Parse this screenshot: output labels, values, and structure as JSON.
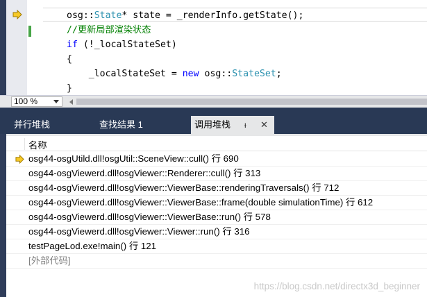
{
  "editor": {
    "lines": [
      {
        "parts": [
          {
            "t": "osg::",
            "c": ""
          },
          {
            "t": "State",
            "c": "type"
          },
          {
            "t": "* state = _renderInfo.getState();",
            "c": ""
          }
        ]
      },
      {
        "parts": [
          {
            "t": "//更新局部渲染状态",
            "c": "cmt"
          }
        ]
      },
      {
        "parts": [
          {
            "t": "if",
            "c": "kw"
          },
          {
            "t": " (!_localStateSet)",
            "c": ""
          }
        ]
      },
      {
        "parts": [
          {
            "t": "{",
            "c": ""
          }
        ]
      },
      {
        "parts": [
          {
            "t": "    _localStateSet = ",
            "c": ""
          },
          {
            "t": "new",
            "c": "kw"
          },
          {
            "t": " osg::",
            "c": ""
          },
          {
            "t": "StateSet",
            "c": "type"
          },
          {
            "t": ";",
            "c": ""
          }
        ]
      },
      {
        "parts": [
          {
            "t": "}",
            "c": ""
          }
        ]
      }
    ],
    "current_line_icon": "yellow-arrow-icon"
  },
  "zoom": {
    "value": "100 %"
  },
  "tabs": [
    {
      "label": "并行堆栈",
      "active": false
    },
    {
      "label": "查找结果 1",
      "active": false
    },
    {
      "label": "调用堆栈",
      "active": true
    }
  ],
  "tab_icons": {
    "pin": "ᵻ",
    "close": "✕"
  },
  "callstack": {
    "header": "名称",
    "rows": [
      {
        "text": "osg44-osgUtild.dll!osgUtil::SceneView::cull() 行 690",
        "current": true
      },
      {
        "text": "osg44-osgViewerd.dll!osgViewer::Renderer::cull() 行 313",
        "current": false
      },
      {
        "text": "osg44-osgViewerd.dll!osgViewer::ViewerBase::renderingTraversals() 行 712",
        "current": false
      },
      {
        "text": "osg44-osgViewerd.dll!osgViewer::ViewerBase::frame(double simulationTime) 行 612",
        "current": false
      },
      {
        "text": "osg44-osgViewerd.dll!osgViewer::ViewerBase::run() 行 578",
        "current": false
      },
      {
        "text": "osg44-osgViewerd.dll!osgViewer::Viewer::run() 行 316",
        "current": false
      },
      {
        "text": "testPageLod.exe!main() 行 121",
        "current": false
      },
      {
        "text": "[外部代码]",
        "current": false,
        "external": true
      }
    ]
  },
  "watermark": "https://blog.csdn.net/directx3d_beginner",
  "colors": {
    "splitter": "#293955",
    "arrow": "#f7c925",
    "keyword": "#0000ff",
    "type": "#2b91af",
    "comment": "#008000"
  }
}
